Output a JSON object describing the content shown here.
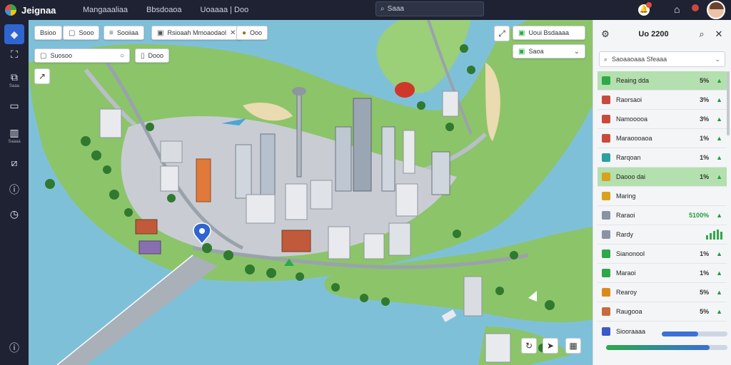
{
  "app": {
    "title": "Jeignaa",
    "nav": [
      "Mangaaaliaa",
      "Bbsdoaoa",
      "Uoaaaa | Doo"
    ],
    "search_label": "Saaa"
  },
  "rail": {
    "items": [
      {
        "icon": "diamond-icon",
        "label": ""
      },
      {
        "icon": "map-icon",
        "label": ""
      },
      {
        "icon": "layers-icon",
        "label": "Saaa"
      },
      {
        "icon": "panel-icon",
        "label": ""
      },
      {
        "icon": "document-icon",
        "label": "Saaaa"
      },
      {
        "icon": "note-icon",
        "label": ""
      },
      {
        "icon": "info-icon",
        "label": ""
      },
      {
        "icon": "clock-icon",
        "label": ""
      },
      {
        "icon": "help-icon",
        "label": ""
      }
    ]
  },
  "map_toolbar": {
    "chip1": "Bsioo",
    "chip2": "Sooo",
    "chip3": "Sooiiaa",
    "chip4": "Rsioaah Mmoaodaol",
    "chip5": "Ooo",
    "search_value": "Suosoo",
    "chip6": "Dooo",
    "route_chip": "Uoui  Bsdaaaa",
    "select_value": "Saoa"
  },
  "panel": {
    "title": "Uo 2200",
    "search_value": "Saoaaoaaa Sfeaaa",
    "rows": [
      {
        "label": "Reaing dda",
        "value": "5%",
        "icon_color": "#2ea84a",
        "highlight": "strong"
      },
      {
        "label": "Raorsaoi",
        "value": "3%",
        "icon_color": "#c94a3c",
        "highlight": ""
      },
      {
        "label": "Namooooa",
        "value": "3%",
        "icon_color": "#c94a3c",
        "highlight": ""
      },
      {
        "label": "Maraoooaoa",
        "value": "1%",
        "icon_color": "#c94a3c",
        "highlight": ""
      },
      {
        "label": "Rarqoan",
        "value": "1%",
        "icon_color": "#2aa0a0",
        "highlight": ""
      },
      {
        "label": "Daooo dai",
        "value": "1%",
        "icon_color": "#d9a21c",
        "highlight": "strong"
      },
      {
        "label": "Maring",
        "value": "",
        "icon_color": "#d9a21c",
        "highlight": ""
      },
      {
        "label": "Raraoi",
        "value": "5100%",
        "icon_color": "#8a93a3",
        "highlight": ""
      },
      {
        "label": "Rardy",
        "value": "",
        "icon_color": "#8a93a3",
        "highlight": ""
      },
      {
        "label": "Sianonool",
        "value": "1%",
        "icon_color": "#2ea84a",
        "highlight": ""
      },
      {
        "label": "Maraoi",
        "value": "1%",
        "icon_color": "#2ea84a",
        "highlight": ""
      },
      {
        "label": "Rearoy",
        "value": "5%",
        "icon_color": "#d98a1c",
        "highlight": ""
      },
      {
        "label": "Raugooa",
        "value": "5%",
        "icon_color": "#c96a3c",
        "highlight": ""
      },
      {
        "label": "Siooraaaa",
        "value": "",
        "icon_color": "#3a5ac9",
        "highlight": ""
      }
    ],
    "progress": [
      0.55,
      0.85
    ]
  },
  "colors": {
    "water": "#7fc0d9",
    "land": "#8cc46a",
    "accent": "#2f65d0",
    "green": "#2ea84a"
  }
}
